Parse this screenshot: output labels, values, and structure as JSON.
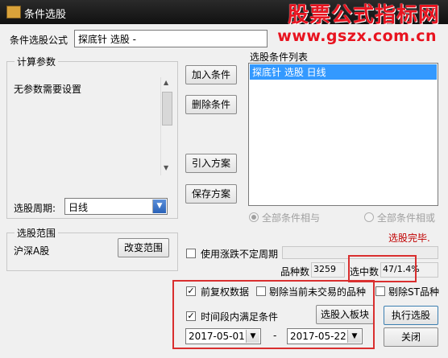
{
  "window": {
    "title": "条件选股"
  },
  "watermark": {
    "line1": "股票公式指标网",
    "line2": "www.gszx.com.cn"
  },
  "formula": {
    "label": "条件选股公式",
    "value": "探底针 选股  -"
  },
  "params": {
    "legend": "计算参数",
    "text": "无参数需要设置"
  },
  "period": {
    "label": "选股周期:",
    "value": "日线"
  },
  "buttons": {
    "add": "加入条件",
    "delete": "删除条件",
    "import": "引入方案",
    "save": "保存方案",
    "change_range": "改变范围",
    "to_block": "选股入板块",
    "execute": "执行选股",
    "close": "关闭"
  },
  "conditions": {
    "label": "选股条件列表",
    "items": [
      "探底针 选股  日线"
    ]
  },
  "logic": {
    "and_label": "全部条件相与",
    "or_label": "全部条件相或"
  },
  "status": "选股完毕.",
  "range": {
    "legend": "选股范围",
    "value": "沪深A股"
  },
  "volatility": {
    "label": "使用涨跌不定周期"
  },
  "stats": {
    "count_label": "品种数",
    "count_value": "3259",
    "selected_label": "选中数",
    "selected_value": "47/1.4%"
  },
  "options": {
    "adjusted_label": "前复权数据",
    "exclude_untraded_label": "剔除当前未交易的品种",
    "exclude_st_label": "剔除ST品种",
    "time_window_label": "时间段内满足条件"
  },
  "dates": {
    "start": "2017-05-01",
    "separator": "-",
    "end": "2017-05-22"
  },
  "colors": {
    "status": "#c00000",
    "highlight_box": "#d92f2f",
    "selection": "#3399ff",
    "watermark": "#e8131f"
  }
}
